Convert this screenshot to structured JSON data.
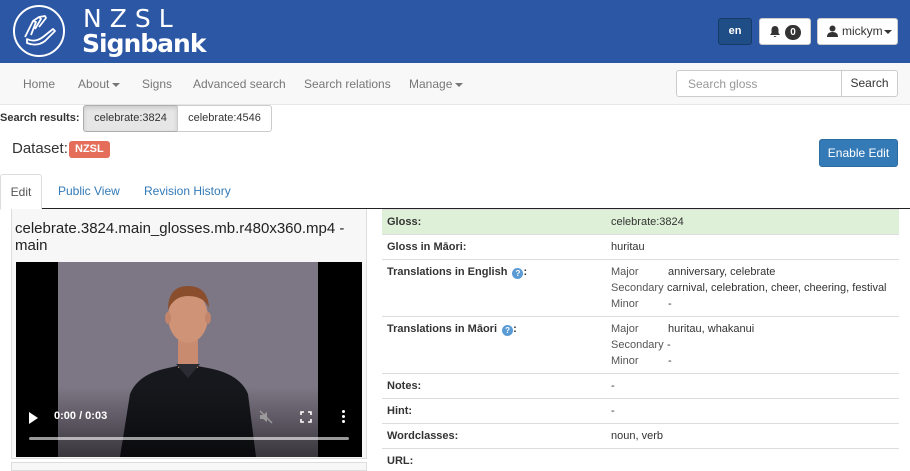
{
  "brand": {
    "logo_line1": "NZSL",
    "logo_line2": "Signbank"
  },
  "header": {
    "language": "en",
    "notifications_count": "0",
    "username": "mickym"
  },
  "nav": {
    "items": [
      {
        "label": "Home"
      },
      {
        "label": "About"
      },
      {
        "label": "Signs"
      },
      {
        "label": "Advanced search"
      },
      {
        "label": "Search relations"
      },
      {
        "label": "Manage"
      }
    ],
    "search_placeholder": "Search gloss",
    "search_button": "Search"
  },
  "search_results": {
    "label": "Search results:",
    "items": [
      "celebrate:3824",
      "celebrate:4546"
    ],
    "active": "celebrate:3824"
  },
  "dataset": {
    "label": "Dataset:",
    "badge": "NZSL",
    "enable_edit": "Enable Edit"
  },
  "tabs": [
    {
      "label": "Edit",
      "active": true
    },
    {
      "label": "Public View",
      "active": false
    },
    {
      "label": "Revision History",
      "active": false
    }
  ],
  "video": {
    "title": "celebrate.3824.main_glosses.mb.r480x360.mp4 - main",
    "time": "0:00 / 0:03",
    "progress": 0
  },
  "gloss_table": {
    "gloss": {
      "label": "Gloss:",
      "value": "celebrate:3824"
    },
    "gloss_maori": {
      "label": "Gloss in Māori:",
      "value": "huritau"
    },
    "translations_english": {
      "label": "Translations in English",
      "major_label": "Major",
      "major": "anniversary, celebrate",
      "secondary_label": "Secondary",
      "secondary": "carnival, celebration, cheer, cheering, festival",
      "minor_label": "Minor",
      "minor": "-"
    },
    "translations_maori": {
      "label": "Translations in Māori",
      "major_label": "Major",
      "major": "huritau, whakanui",
      "secondary_label": "Secondary",
      "secondary": "-",
      "minor_label": "Minor",
      "minor": "-"
    },
    "notes": {
      "label": "Notes:",
      "value": "-"
    },
    "hint": {
      "label": "Hint:",
      "value": "-"
    },
    "wordclasses": {
      "label": "Wordclasses:",
      "value": "noun, verb"
    },
    "url": {
      "label": "URL:",
      "value": ""
    }
  },
  "colors": {
    "brand_blue": "#2b57a5",
    "primary": "#337ab7",
    "badge_red": "#e46e5a",
    "success_row": "#dff0d8"
  }
}
